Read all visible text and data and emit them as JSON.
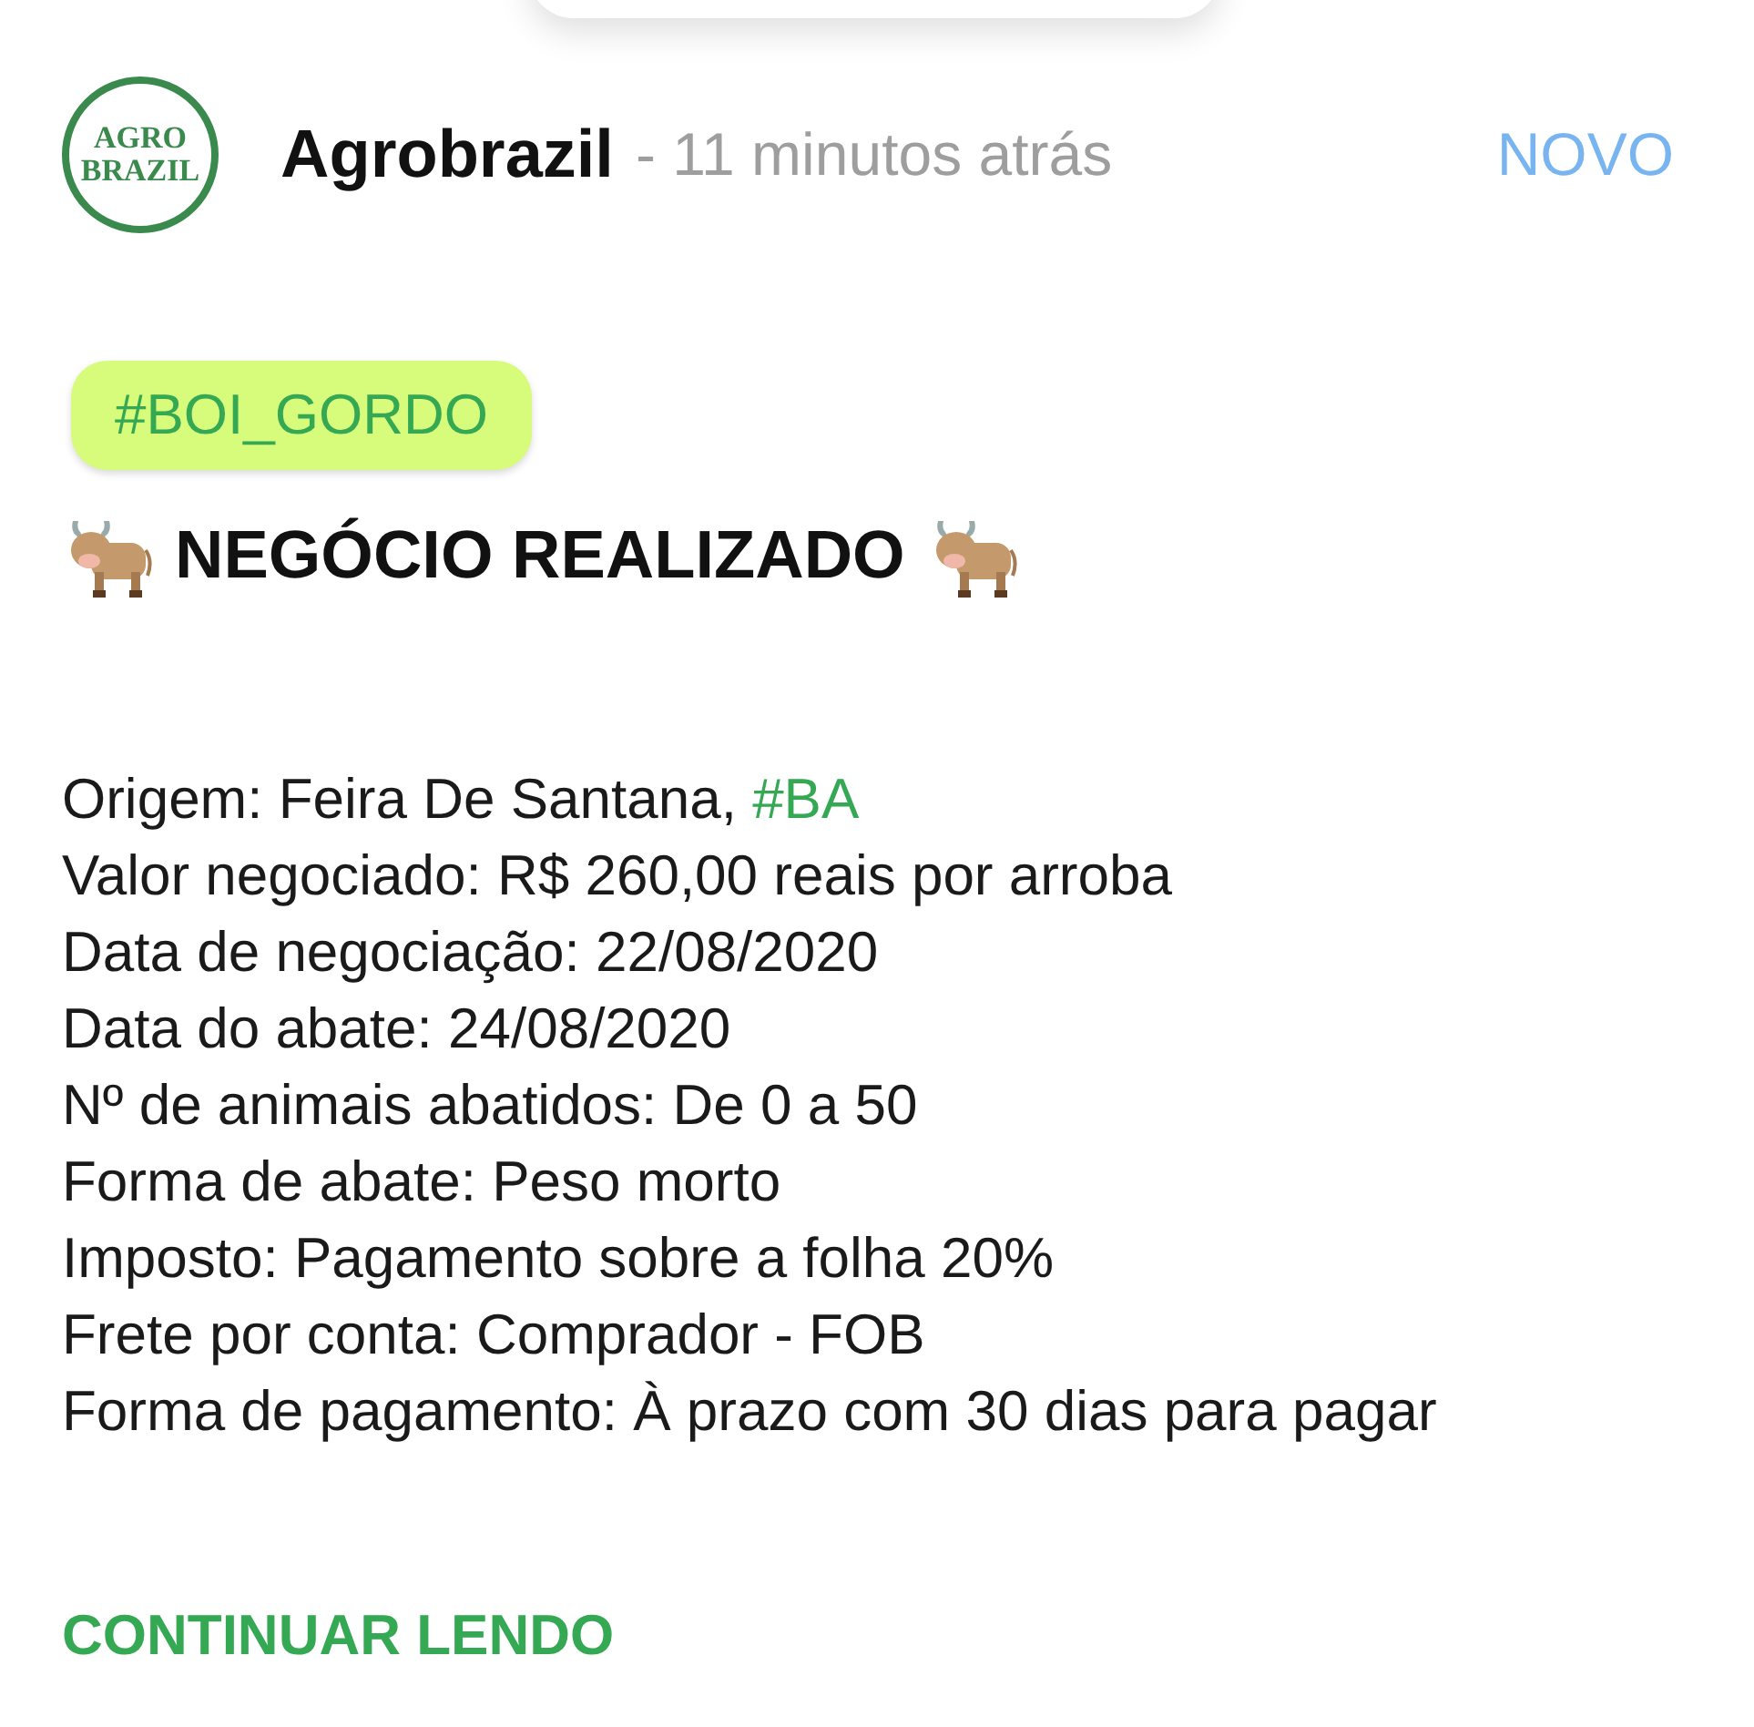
{
  "post": {
    "logo": [
      "AGRO",
      "BRAZIL"
    ],
    "author": "Agrobrazil",
    "time": "- 11 minutos atrás",
    "badge": "NOVO"
  },
  "tag": "#BOI_GORDO",
  "title": "NEGÓCIO REALIZADO",
  "lines": [
    {
      "text": "Origem: Feira De Santana, ",
      "hashtag": "#BA"
    },
    {
      "text": "Valor negociado: R$ 260,00 reais por arroba"
    },
    {
      "text": "Data de negociação: 22/08/2020"
    },
    {
      "text": "Data do abate: 24/08/2020"
    },
    {
      "text": "Nº de animais abatidos: De 0 a 50"
    },
    {
      "text": "Forma de abate: Peso morto"
    },
    {
      "text": "Imposto: Pagamento sobre a folha 20%"
    },
    {
      "text": "Frete por conta: Comprador - FOB"
    },
    {
      "text": "Forma de pagamento: À prazo com 30 dias para pagar"
    }
  ],
  "more": "CONTINUAR LENDO"
}
